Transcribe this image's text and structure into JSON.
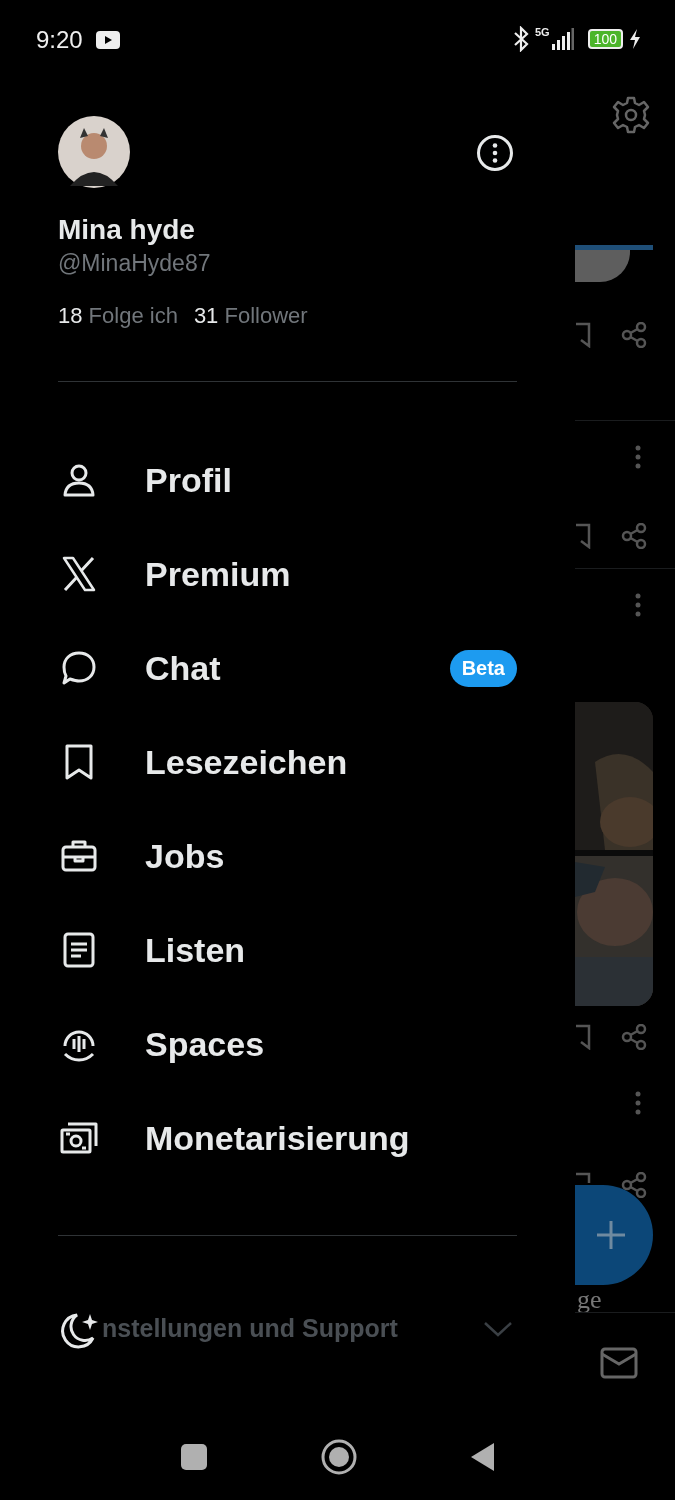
{
  "status_bar": {
    "network": "5G",
    "clock": "9:20",
    "battery": "100"
  },
  "profile": {
    "name": "Mina hyde",
    "handle": "@MinaHyde87",
    "following_count": "18",
    "following_label": "Folge ich",
    "followers_count": "31",
    "followers_label": "Follower"
  },
  "menu": [
    {
      "label": "Profil"
    },
    {
      "label": "Premium"
    },
    {
      "label": "Chat",
      "badge": "Beta"
    },
    {
      "label": "Lesezeichen"
    },
    {
      "label": "Jobs"
    },
    {
      "label": "Listen"
    },
    {
      "label": "Spaces"
    },
    {
      "label": "Monetarisierung"
    }
  ],
  "settings": {
    "label": "nstellungen und Support",
    "expanded": false
  },
  "background_feed": {
    "caption_fragment": "ge"
  }
}
